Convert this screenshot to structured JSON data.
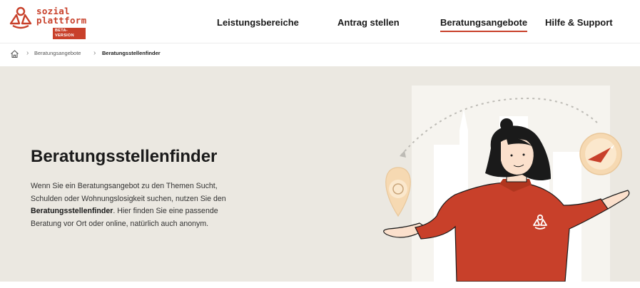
{
  "logo": {
    "line1": "sozial",
    "line2": "plattform",
    "badge": "BETA-VERSION"
  },
  "nav": {
    "items": [
      {
        "label": "Leistungsbereiche"
      },
      {
        "label": "Antrag stellen"
      },
      {
        "label": "Beratungsangebote"
      },
      {
        "label": "Hilfe & Support"
      }
    ],
    "active": "Beratungsangebote"
  },
  "breadcrumb": {
    "items": [
      {
        "label": "Beratungsangebote"
      },
      {
        "label": "Beratungsstellenfinder"
      }
    ]
  },
  "hero": {
    "title": "Beratungsstellenfinder",
    "text_before": "Wenn Sie ein Beratungsangebot zu den Themen Sucht, Schulden oder Wohnungslosigkeit suchen, nutzen Sie den ",
    "text_bold": "Beratungsstellenfinder",
    "text_after": ". Hier finden Sie eine passende Beratung vor Ort oder online, natürlich auch anonym."
  },
  "colors": {
    "brand": "#c8402a",
    "hero_bg": "#ebe8e1",
    "skin": "#fbe0cc",
    "pin": "#f6d9b2"
  }
}
